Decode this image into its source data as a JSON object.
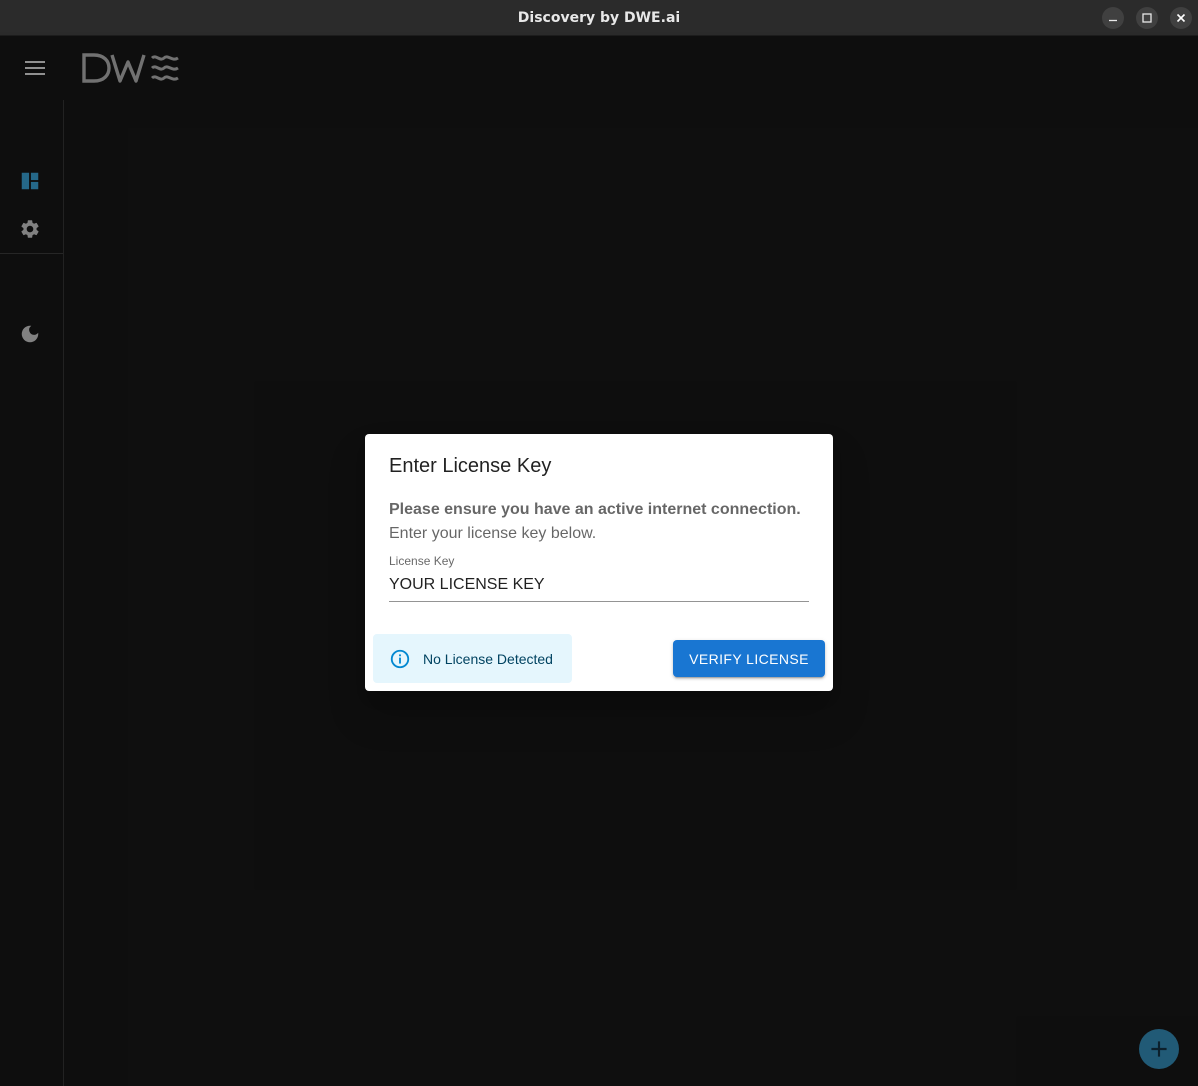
{
  "window": {
    "title": "Discovery by DWE.ai"
  },
  "appbar": {
    "logo_text": "DW≋"
  },
  "sidebar": {
    "items": [
      {
        "name": "dashboard",
        "icon": "dashboard-icon",
        "active": true
      },
      {
        "name": "settings",
        "icon": "gear-icon",
        "active": false
      },
      {
        "name": "theme",
        "icon": "moon-icon",
        "active": false
      }
    ]
  },
  "dialog": {
    "title": "Enter License Key",
    "warning": "Please ensure you have an active internet connection.",
    "instruction": "Enter your license key below.",
    "field_label": "License Key",
    "field_value": "YOUR LICENSE KEY",
    "status_text": "No License Detected",
    "verify_label": "VERIFY LICENSE"
  },
  "colors": {
    "accent": "#1976d2",
    "dashboard_icon": "#2e7fa8",
    "info_bg": "#e5f6fd",
    "info_fg": "#014361"
  }
}
